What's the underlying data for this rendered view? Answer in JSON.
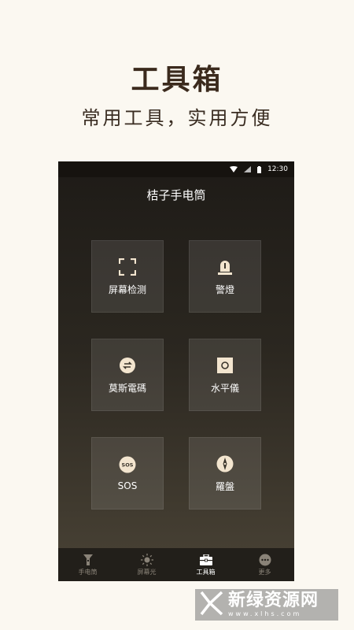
{
  "promo": {
    "title": "工具箱",
    "subtitle": "常用工具，实用方便"
  },
  "status_bar": {
    "time": "12:30",
    "icons": [
      "wifi-icon",
      "signal-icon",
      "battery-icon"
    ]
  },
  "app": {
    "title": "桔子手电筒"
  },
  "tools": [
    {
      "label": "屏幕检测",
      "icon": "screen-test-icon"
    },
    {
      "label": "警燈",
      "icon": "alarm-light-icon"
    },
    {
      "label": "莫斯電碼",
      "icon": "morse-code-icon"
    },
    {
      "label": "水平儀",
      "icon": "level-icon"
    },
    {
      "label": "SOS",
      "icon": "sos-icon"
    },
    {
      "label": "羅盤",
      "icon": "compass-icon"
    }
  ],
  "tabs": [
    {
      "label": "手电筒",
      "icon": "flashlight-icon",
      "active": false
    },
    {
      "label": "屏幕光",
      "icon": "sun-icon",
      "active": false
    },
    {
      "label": "工具箱",
      "icon": "toolbox-icon",
      "active": true
    },
    {
      "label": "更多",
      "icon": "more-icon",
      "active": false
    }
  ],
  "watermark": {
    "text": "新绿资源网",
    "url": "www.xlhs.com"
  },
  "colors": {
    "background": "#fbf8f1",
    "title_text": "#3b2a1d",
    "icon_cream": "#f3e5cf",
    "tab_inactive": "#8a8378"
  }
}
